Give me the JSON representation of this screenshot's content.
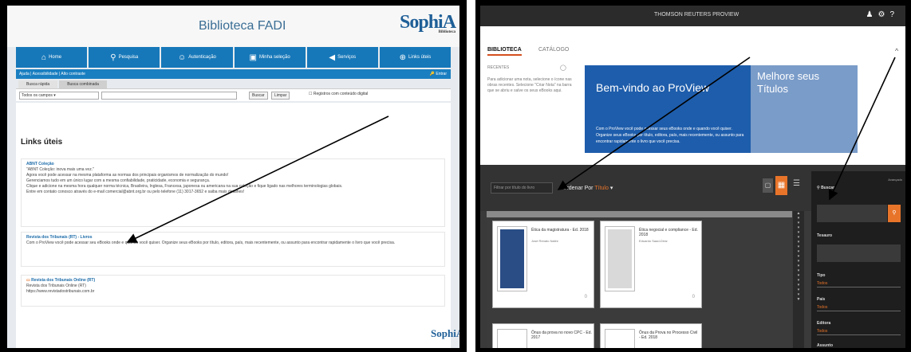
{
  "left": {
    "title": "Biblioteca FADI",
    "logo": "SophiA",
    "logo_sub": "Biblioteca",
    "nav": [
      {
        "icon": "home-icon",
        "glyph": "⌂",
        "label": "Home"
      },
      {
        "icon": "search-icon",
        "glyph": "⚲",
        "label": "Pesquisa"
      },
      {
        "icon": "user-icon",
        "glyph": "☺",
        "label": "Autenticação"
      },
      {
        "icon": "gift-icon",
        "glyph": "▣",
        "label": "Minha seleção"
      },
      {
        "icon": "megaphone-icon",
        "glyph": "◀",
        "label": "Serviços"
      },
      {
        "icon": "link-icon",
        "glyph": "⊕",
        "label": "Links úteis"
      }
    ],
    "subnav": "Ajuda | Acessibilidade | Alto contraste",
    "exit": "Entrar",
    "tabs": [
      "Busca rápida",
      "Busca combinada"
    ],
    "select_value": "Todos os campos",
    "buttons": [
      "Buscar",
      "Limpar"
    ],
    "checkbox_label": "Registros com conteúdo digital",
    "heading": "Links úteis",
    "cards": [
      {
        "title": "ABNT Coleção",
        "body": "\"ABNT Coleção: inova mais uma vez.\"\nAgora você pode acessar na mesma plataforma as normas dos principais organismos de normalização do mundo!\nGerenciamos tudo em um único lugar com a mesma confiabilidade, praticidade, economia e segurança.\nClique e adicione na mesma hora qualquer norma técnica, Brasileira, Inglesa, Francesa, japonesa ou americana na sua coleção e fique ligado nas melhores terminologias globais.\nEntre em contato conosco através do e-mail comercial@abnt.org.br ou pelo telefone (11) 3017-3652 e saiba mais detalhes!"
      },
      {
        "title": "Revista dos Tribunais (RT) - Livros",
        "body": "Com o ProView você pode acessar seu eBooks onde e quando você quiser. Organize seus eBooks por título, editora, país, mais recentemente, ou assunto para encontrar rapidamente o livro que você precisa."
      },
      {
        "title": "Revista dos Tribunais Online (RT)",
        "body": "Revista dos Tribunais Online (RT)\nhttps://www.revistadostribunais.com.br"
      }
    ],
    "footer_logo": "SophiA"
  },
  "right": {
    "topbar_title": "THOMSON REUTERS PROVIEW",
    "tabs": [
      "BIBLIOTECA",
      "CATÁLOGO"
    ],
    "recent_label": "RECENTES",
    "recent_text": "Para adicionar uma nota, selecione o ícone nas obras recentes. Selecione \"Criar Nota\" na barra que se abriu e salve os seus eBooks aqui.",
    "banner_title": "Bem-vindo ao ProView",
    "banner_text": "Com o ProView você pode acessar seus eBooks onde e quando você quiser. Organize seus eBooks por título, editora, país, mais recentemente, ou assunto para encontrar rapidamente o livro que você precisa.",
    "banner_side": "Melhore seus Títulos",
    "filter_placeholder": "Filtrar por título do livro",
    "order_label": "Ordenar Por",
    "order_value": "Título",
    "books": [
      {
        "title": "Ética da magistratura - Ed. 2018",
        "author": "José Renato Nalini",
        "count": "0"
      },
      {
        "title": "Ética negocial e compliance - Ed. 2018",
        "author": "Eduardo Saad-Diniz",
        "count": "0"
      },
      {
        "title": "Ônus da prova no novo CPC - Ed. 2017",
        "author": "",
        "count": ""
      },
      {
        "title": "Ônus da Prova no Processo Civil - Ed. 2018",
        "author": "",
        "count": ""
      }
    ],
    "side": {
      "search_label": "Buscar",
      "advanced": "Avançado",
      "thesaurus_label": "Tesauro",
      "filters": [
        {
          "label": "Tipo",
          "value": "Todos"
        },
        {
          "label": "País",
          "value": "Todos"
        },
        {
          "label": "Editora",
          "value": "Todos"
        },
        {
          "label": "Assunto",
          "value": ""
        }
      ]
    }
  },
  "colors": {
    "sophia_blue": "#1778b9",
    "proview_orange": "#e8742a",
    "proview_blue": "#1e5dab"
  }
}
